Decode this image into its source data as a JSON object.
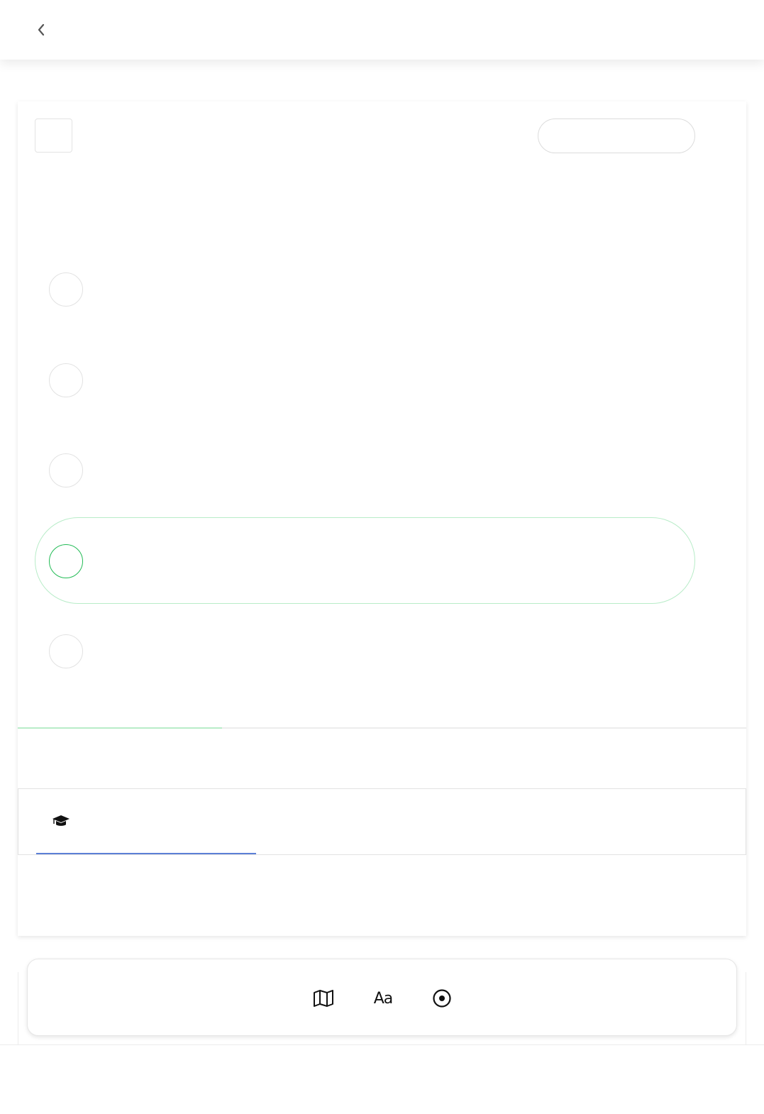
{
  "header": {
    "back_icon": "chevron-left-icon"
  },
  "question": {
    "options": [
      {
        "label": "",
        "selected": false
      },
      {
        "label": "",
        "selected": false
      },
      {
        "label": "",
        "selected": false
      },
      {
        "label": "",
        "selected": true
      },
      {
        "label": "",
        "selected": false
      }
    ],
    "progress": 0.28
  },
  "tabs": {
    "learn_icon": "graduation-cap-icon"
  },
  "toolbar": {
    "tools": [
      {
        "icon": "map-icon"
      },
      {
        "icon": "font-size-icon",
        "glyph": "Aa"
      },
      {
        "icon": "target-icon"
      }
    ]
  },
  "colors": {
    "selected": "#22bb55",
    "selected_border": "#b8ecc8",
    "tab_underline": "#5b7fd6"
  }
}
